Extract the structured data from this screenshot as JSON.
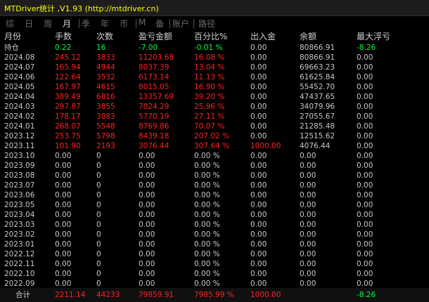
{
  "window": {
    "title": "MTDriver统计 ,V1.93 (http://mtdriver.cn)"
  },
  "colors": {
    "title": "#ffff00",
    "positive": "#ff2020",
    "negative": "#00ff40",
    "neutral": "#c8c8c8",
    "nav_inactive": "#6b6b6b",
    "nav_active": "#dcdcdc"
  },
  "nav": {
    "items": [
      "综",
      "日",
      "周",
      "月",
      "季",
      "年",
      "币",
      "M",
      "备",
      "账户",
      "路径"
    ],
    "active": "月"
  },
  "table": {
    "columns": [
      "月份",
      "手数",
      "次数",
      "盈亏金额",
      "百分比%",
      "出入金",
      "余额",
      "最大浮亏"
    ],
    "rows": [
      {
        "cells": [
          "持仓",
          "0.22",
          "16",
          "-7.00",
          "-0.01 %",
          "0.00",
          "80866.91",
          "-8.26"
        ],
        "colors": [
          "n",
          "g",
          "g",
          "g",
          "g",
          "n",
          "n",
          "g"
        ]
      },
      {
        "cells": [
          "2024.08",
          "245.12",
          "3833",
          "11203.68",
          "16.08 %",
          "0.00",
          "80866.91",
          "0.00"
        ],
        "colors": [
          "n",
          "r",
          "r",
          "r",
          "r",
          "n",
          "n",
          "n"
        ]
      },
      {
        "cells": [
          "2024.07",
          "165.94",
          "4944",
          "8037.39",
          "13.04 %",
          "0.00",
          "69663.23",
          "0.00"
        ],
        "colors": [
          "n",
          "r",
          "r",
          "r",
          "r",
          "n",
          "n",
          "n"
        ]
      },
      {
        "cells": [
          "2024.06",
          "122.64",
          "3532",
          "6173.14",
          "11.13 %",
          "0.00",
          "61625.84",
          "0.00"
        ],
        "colors": [
          "n",
          "r",
          "r",
          "r",
          "r",
          "n",
          "n",
          "n"
        ]
      },
      {
        "cells": [
          "2024.05",
          "167.97",
          "4615",
          "8015.05",
          "16.90 %",
          "0.00",
          "55452.70",
          "0.00"
        ],
        "colors": [
          "n",
          "r",
          "r",
          "r",
          "r",
          "n",
          "n",
          "n"
        ]
      },
      {
        "cells": [
          "2024.04",
          "389.49",
          "6816",
          "13357.69",
          "39.20 %",
          "0.00",
          "47437.65",
          "0.00"
        ],
        "colors": [
          "n",
          "r",
          "r",
          "r",
          "r",
          "n",
          "n",
          "n"
        ]
      },
      {
        "cells": [
          "2024.03",
          "297.87",
          "3855",
          "7024.29",
          "25.96 %",
          "0.00",
          "34079.96",
          "0.00"
        ],
        "colors": [
          "n",
          "r",
          "r",
          "r",
          "r",
          "n",
          "n",
          "n"
        ]
      },
      {
        "cells": [
          "2024.02",
          "178.17",
          "3083",
          "5770.19",
          "27.11 %",
          "0.00",
          "27055.67",
          "0.00"
        ],
        "colors": [
          "n",
          "r",
          "r",
          "r",
          "r",
          "n",
          "n",
          "n"
        ]
      },
      {
        "cells": [
          "2024.01",
          "268.07",
          "5548",
          "8769.86",
          "70.07 %",
          "0.00",
          "21285.48",
          "0.00"
        ],
        "colors": [
          "n",
          "r",
          "r",
          "r",
          "r",
          "n",
          "n",
          "n"
        ]
      },
      {
        "cells": [
          "2023.12",
          "253.75",
          "5798",
          "8439.18",
          "207.02 %",
          "0.00",
          "12515.62",
          "0.00"
        ],
        "colors": [
          "n",
          "r",
          "r",
          "r",
          "r",
          "n",
          "n",
          "n"
        ]
      },
      {
        "cells": [
          "2023.11",
          "101.90",
          "2193",
          "3076.44",
          "307.64 %",
          "1000.00",
          "4076.44",
          "0.00"
        ],
        "colors": [
          "n",
          "r",
          "r",
          "r",
          "r",
          "r",
          "n",
          "n"
        ]
      },
      {
        "cells": [
          "2023.10",
          "0.00",
          "0",
          "0.00",
          "0.00 %",
          "0.00",
          "0.00",
          "0.00"
        ],
        "colors": [
          "n",
          "n",
          "n",
          "n",
          "n",
          "n",
          "n",
          "n"
        ]
      },
      {
        "cells": [
          "2023.09",
          "0.00",
          "0",
          "0.00",
          "0.00 %",
          "0.00",
          "0.00",
          "0.00"
        ],
        "colors": [
          "n",
          "n",
          "n",
          "n",
          "n",
          "n",
          "n",
          "n"
        ]
      },
      {
        "cells": [
          "2023.08",
          "0.00",
          "0",
          "0.00",
          "0.00 %",
          "0.00",
          "0.00",
          "0.00"
        ],
        "colors": [
          "n",
          "n",
          "n",
          "n",
          "n",
          "n",
          "n",
          "n"
        ]
      },
      {
        "cells": [
          "2023.07",
          "0.00",
          "0",
          "0.00",
          "0.00 %",
          "0.00",
          "0.00",
          "0.00"
        ],
        "colors": [
          "n",
          "n",
          "n",
          "n",
          "n",
          "n",
          "n",
          "n"
        ]
      },
      {
        "cells": [
          "2023.06",
          "0.00",
          "0",
          "0.00",
          "0.00 %",
          "0.00",
          "0.00",
          "0.00"
        ],
        "colors": [
          "n",
          "n",
          "n",
          "n",
          "n",
          "n",
          "n",
          "n"
        ]
      },
      {
        "cells": [
          "2023.05",
          "0.00",
          "0",
          "0.00",
          "0.00 %",
          "0.00",
          "0.00",
          "0.00"
        ],
        "colors": [
          "n",
          "n",
          "n",
          "n",
          "n",
          "n",
          "n",
          "n"
        ]
      },
      {
        "cells": [
          "2023.04",
          "0.00",
          "0",
          "0.00",
          "0.00 %",
          "0.00",
          "0.00",
          "0.00"
        ],
        "colors": [
          "n",
          "n",
          "n",
          "n",
          "n",
          "n",
          "n",
          "n"
        ]
      },
      {
        "cells": [
          "2023.03",
          "0.00",
          "0",
          "0.00",
          "0.00 %",
          "0.00",
          "0.00",
          "0.00"
        ],
        "colors": [
          "n",
          "n",
          "n",
          "n",
          "n",
          "n",
          "n",
          "n"
        ]
      },
      {
        "cells": [
          "2023.02",
          "0.00",
          "0",
          "0.00",
          "0.00 %",
          "0.00",
          "0.00",
          "0.00"
        ],
        "colors": [
          "n",
          "n",
          "n",
          "n",
          "n",
          "n",
          "n",
          "n"
        ]
      },
      {
        "cells": [
          "2023.01",
          "0.00",
          "0",
          "0.00",
          "0.00 %",
          "0.00",
          "0.00",
          "0.00"
        ],
        "colors": [
          "n",
          "n",
          "n",
          "n",
          "n",
          "n",
          "n",
          "n"
        ]
      },
      {
        "cells": [
          "2022.12",
          "0.00",
          "0",
          "0.00",
          "0.00 %",
          "0.00",
          "0.00",
          "0.00"
        ],
        "colors": [
          "n",
          "n",
          "n",
          "n",
          "n",
          "n",
          "n",
          "n"
        ]
      },
      {
        "cells": [
          "2022.11",
          "0.00",
          "0",
          "0.00",
          "0.00 %",
          "0.00",
          "0.00",
          "0.00"
        ],
        "colors": [
          "n",
          "n",
          "n",
          "n",
          "n",
          "n",
          "n",
          "n"
        ]
      },
      {
        "cells": [
          "2022.10",
          "0.00",
          "0",
          "0.00",
          "0.00 %",
          "0.00",
          "0.00",
          "0.00"
        ],
        "colors": [
          "n",
          "n",
          "n",
          "n",
          "n",
          "n",
          "n",
          "n"
        ]
      },
      {
        "cells": [
          "2022.09",
          "0.00",
          "0",
          "0.00",
          "0.00 %",
          "0.00",
          "0.00",
          "0.00"
        ],
        "colors": [
          "n",
          "n",
          "n",
          "n",
          "n",
          "n",
          "n",
          "n"
        ]
      }
    ],
    "footer": {
      "cells": [
        "合计",
        "2211.14",
        "44233",
        "79859.91",
        "7985.99 %",
        "1000.00",
        "",
        "-8.26"
      ],
      "colors": [
        "n",
        "r",
        "r",
        "r",
        "r",
        "r",
        "n",
        "g"
      ]
    }
  }
}
